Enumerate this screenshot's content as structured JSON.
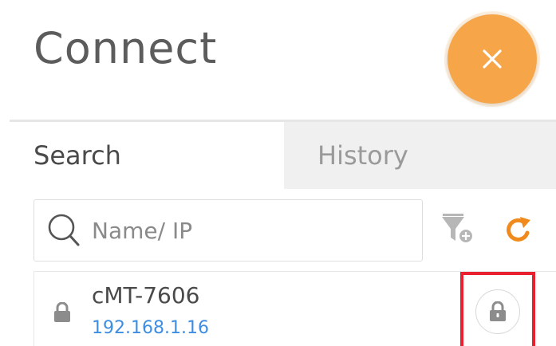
{
  "header": {
    "title": "Connect",
    "close_icon": "close-icon",
    "accent_color": "#f6a649"
  },
  "tabs": [
    {
      "label": "Search",
      "active": true
    },
    {
      "label": "History",
      "active": false
    }
  ],
  "search": {
    "placeholder": "Name/ IP",
    "value": "",
    "icon": "search-icon"
  },
  "toolbar": {
    "filter_icon": "filter-add-icon",
    "refresh_icon": "refresh-icon",
    "refresh_color": "#f08a1c"
  },
  "devices": [
    {
      "name": "cMT-7606",
      "ip": "192.168.1.16",
      "status_icon": "lock-icon",
      "action_icon": "lock-button-icon",
      "highlighted": true
    }
  ],
  "colors": {
    "ip_link": "#3d8ee3",
    "highlight": "#e8202f",
    "history_tab_bg": "#f0f0f0"
  }
}
